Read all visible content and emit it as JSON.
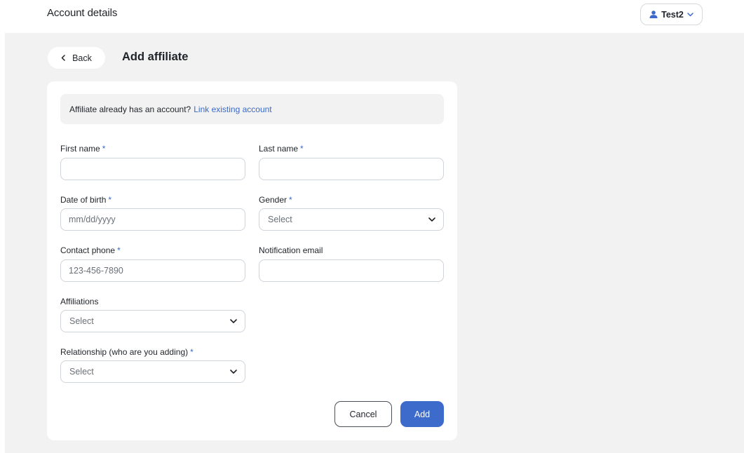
{
  "header": {
    "title": "Account details",
    "user_name": "Test2",
    "user_icon": "user-icon",
    "chevron_icon": "chevron-down-icon"
  },
  "page": {
    "back_label": "Back",
    "back_icon": "chevron-left-icon",
    "title": "Add affiliate"
  },
  "notice": {
    "text": "Affiliate already has an account?",
    "link_text": "Link existing account"
  },
  "form": {
    "required_marker": "*",
    "first_name": {
      "label": "First name",
      "value": "",
      "placeholder": ""
    },
    "last_name": {
      "label": "Last name",
      "value": "",
      "placeholder": ""
    },
    "date_of_birth": {
      "label": "Date of birth",
      "value": "",
      "placeholder": "mm/dd/yyyy"
    },
    "gender": {
      "label": "Gender",
      "selected": "Select"
    },
    "contact_phone": {
      "label": "Contact phone",
      "value": "",
      "placeholder": "123-456-7890"
    },
    "notification_email": {
      "label": "Notification email",
      "value": "",
      "placeholder": ""
    },
    "affiliations": {
      "label": "Affiliations",
      "selected": "Select"
    },
    "relationship": {
      "label": "Relationship (who are you adding)",
      "selected": "Select"
    }
  },
  "actions": {
    "cancel_label": "Cancel",
    "add_label": "Add"
  },
  "colors": {
    "accent": "#3d6bcb",
    "link": "#3a6ac8",
    "background": "#f2f2f2"
  }
}
